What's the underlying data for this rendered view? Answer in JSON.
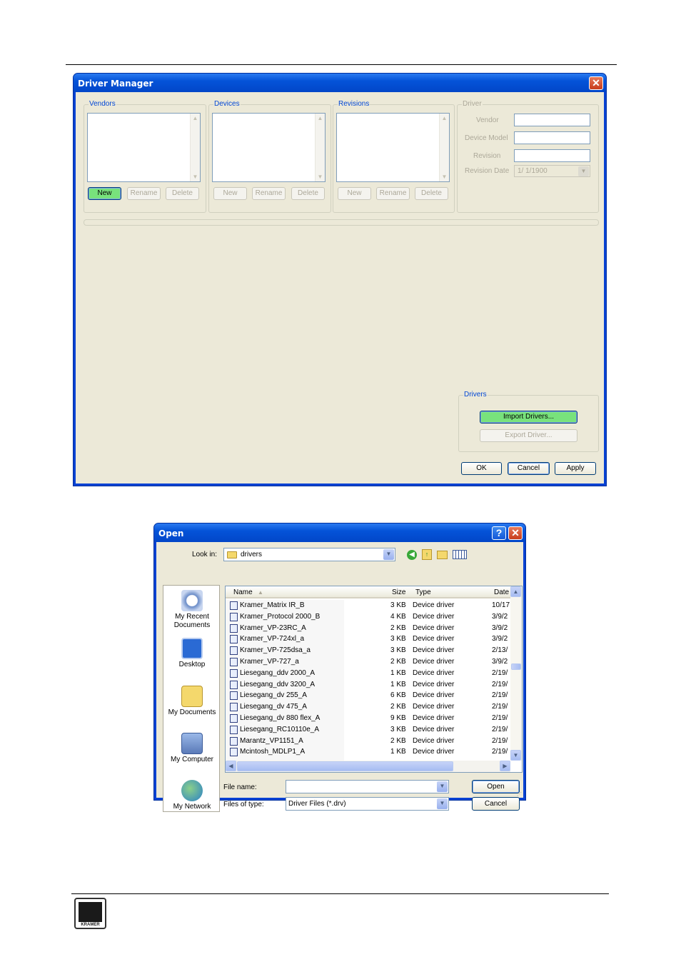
{
  "driver_manager": {
    "title": "Driver Manager",
    "close_label": "✕",
    "vendors": {
      "label": "Vendors",
      "new": "New",
      "rename": "Rename",
      "delete": "Delete"
    },
    "devices": {
      "label": "Devices",
      "new": "New",
      "rename": "Rename",
      "delete": "Delete"
    },
    "revisions": {
      "label": "Revisions",
      "new": "New",
      "rename": "Rename",
      "delete": "Delete"
    },
    "driver": {
      "label": "Driver",
      "vendor_label": "Vendor",
      "device_model_label": "Device Model",
      "revision_label": "Revision",
      "revision_date_label": "Revision Date",
      "revision_date_value": "1/ 1/1900"
    },
    "drivers_group": {
      "label": "Drivers",
      "import": "Import Drivers...",
      "export": "Export Driver..."
    },
    "ok": "OK",
    "cancel": "Cancel",
    "apply": "Apply"
  },
  "open_dialog": {
    "title": "Open",
    "help_label": "?",
    "close_label": "✕",
    "look_in_label": "Look in:",
    "look_in_value": "drivers",
    "places": [
      "My Recent Documents",
      "Desktop",
      "My Documents",
      "My Computer",
      "My Network"
    ],
    "columns": {
      "name": "Name",
      "size": "Size",
      "type": "Type",
      "date": "Date"
    },
    "files": [
      {
        "name": "Kramer_Matrix IR_B",
        "size": "3 KB",
        "type": "Device driver",
        "date": "10/17"
      },
      {
        "name": "Kramer_Protocol 2000_B",
        "size": "4 KB",
        "type": "Device driver",
        "date": "3/9/2"
      },
      {
        "name": "Kramer_VP-23RC_A",
        "size": "2 KB",
        "type": "Device driver",
        "date": "3/9/2"
      },
      {
        "name": "Kramer_VP-724xl_a",
        "size": "3 KB",
        "type": "Device driver",
        "date": "3/9/2"
      },
      {
        "name": "Kramer_VP-725dsa_a",
        "size": "3 KB",
        "type": "Device driver",
        "date": "2/13/"
      },
      {
        "name": "Kramer_VP-727_a",
        "size": "2 KB",
        "type": "Device driver",
        "date": "3/9/2"
      },
      {
        "name": "Liesegang_ddv 2000_A",
        "size": "1 KB",
        "type": "Device driver",
        "date": "2/19/"
      },
      {
        "name": "Liesegang_ddv 3200_A",
        "size": "1 KB",
        "type": "Device driver",
        "date": "2/19/"
      },
      {
        "name": "Liesegang_dv 255_A",
        "size": "6 KB",
        "type": "Device driver",
        "date": "2/19/"
      },
      {
        "name": "Liesegang_dv 475_A",
        "size": "2 KB",
        "type": "Device driver",
        "date": "2/19/"
      },
      {
        "name": "Liesegang_dv 880 flex_A",
        "size": "9 KB",
        "type": "Device driver",
        "date": "2/19/"
      },
      {
        "name": "Liesegang_RC10110e_A",
        "size": "3 KB",
        "type": "Device driver",
        "date": "2/19/"
      },
      {
        "name": "Marantz_VP1151_A",
        "size": "2 KB",
        "type": "Device driver",
        "date": "2/19/"
      },
      {
        "name": "Mcintosh_MDLP1_A",
        "size": "1 KB",
        "type": "Device driver",
        "date": "2/19/"
      }
    ],
    "file_name_label": "File name:",
    "file_name_value": "",
    "files_of_type_label": "Files of type:",
    "files_of_type_value": "Driver Files (*.drv)",
    "open": "Open",
    "cancel": "Cancel"
  },
  "footer": {
    "logo_text": "KRAMER"
  }
}
